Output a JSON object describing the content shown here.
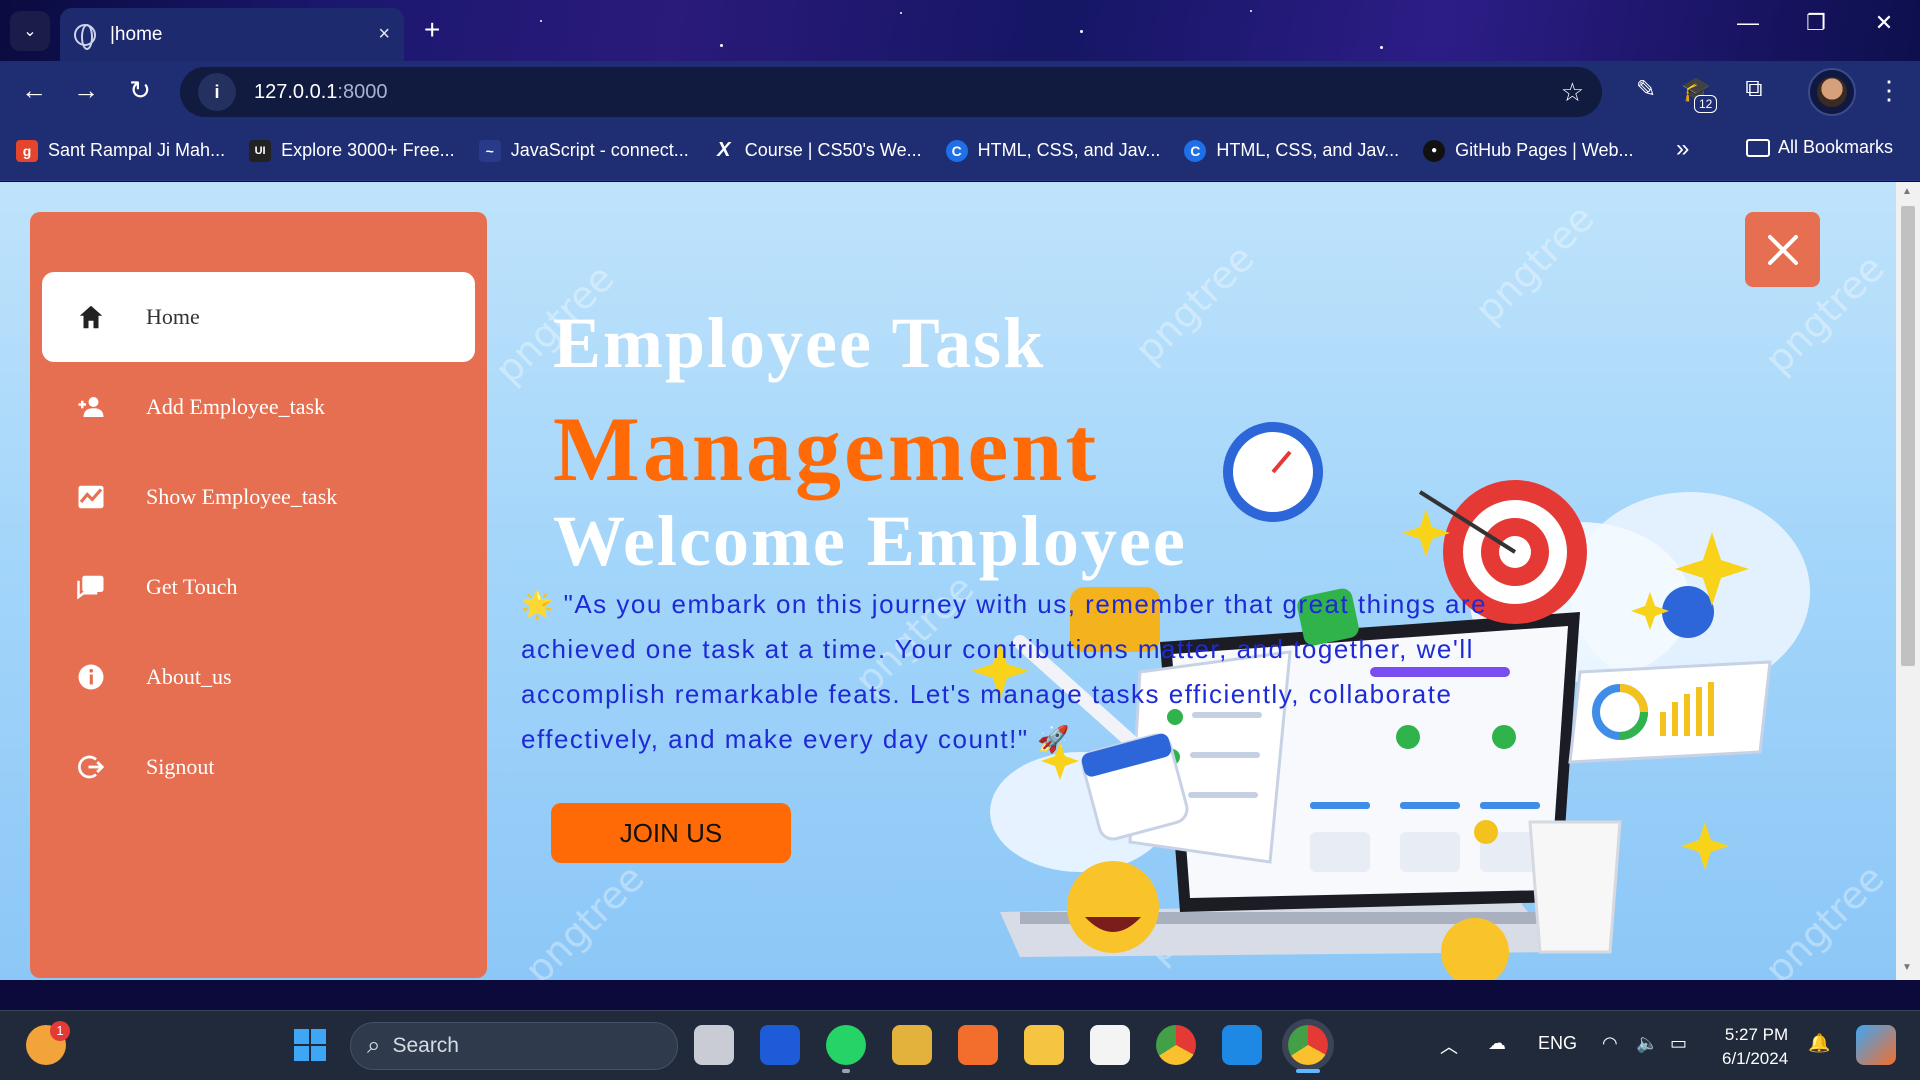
{
  "browser": {
    "tab_title": "|home",
    "tab_close": "×",
    "new_tab": "+",
    "window_controls": {
      "minimize": "—",
      "restore": "❐",
      "close": "✕"
    },
    "url_host": "127.0.0.1",
    "url_port": ":8000",
    "extensions_badge": "12",
    "bookmarks": [
      {
        "label": "Sant Rampal Ji Mah...",
        "icon": "sant-rampal-favicon",
        "color": "#e5452c",
        "glyph": "g"
      },
      {
        "label": "Explore 3000+ Free...",
        "icon": "ui-favicon",
        "color": "#222222",
        "glyph": "UI"
      },
      {
        "label": "JavaScript - connect...",
        "icon": "javascript-favicon",
        "color": "#2a3a8a",
        "glyph": "~"
      },
      {
        "label": "Course | CS50's We...",
        "icon": "x-favicon",
        "color": "#1f2d72",
        "glyph": "X"
      },
      {
        "label": "HTML, CSS, and Jav...",
        "icon": "c-favicon",
        "color": "#1e6fe8",
        "glyph": "C"
      },
      {
        "label": "HTML, CSS, and Jav...",
        "icon": "c-favicon",
        "color": "#1e6fe8",
        "glyph": "C"
      },
      {
        "label": "GitHub Pages | Web...",
        "icon": "github-favicon",
        "color": "#1f2d72",
        "glyph": "●"
      }
    ],
    "bookmarks_overflow": "»",
    "all_bookmarks": "All Bookmarks"
  },
  "sidebar": {
    "items": [
      {
        "label": "Home",
        "icon": "home-icon",
        "active": true
      },
      {
        "label": "Add Employee_task",
        "icon": "add-person-icon",
        "active": false
      },
      {
        "label": "Show Employee_task",
        "icon": "chart-icon",
        "active": false
      },
      {
        "label": "Get Touch",
        "icon": "message-icon",
        "active": false
      },
      {
        "label": "About_us",
        "icon": "info-icon",
        "active": false
      },
      {
        "label": "Signout",
        "icon": "signout-icon",
        "active": false
      }
    ]
  },
  "hero": {
    "line1": "Employee Task",
    "line2": "Management",
    "line3": "Welcome Employee",
    "quote": "\"As you embark on this journey with us, remember that great things are achieved one task at a time. Your contributions matter, and together, we'll accomplish remarkable feats. Let's manage tasks efficiently, collaborate effectively, and make every day count!\"",
    "quote_lead_emoji": "🌟",
    "quote_trail_emoji": "🚀",
    "join_button": "JOIN US",
    "watermark": "pngtree"
  },
  "taskbar": {
    "search_placeholder": "Search",
    "notification_count": "1",
    "language": "ENG",
    "time": "5:27 PM",
    "date": "6/1/2024"
  },
  "colors": {
    "sidebar": "#e76f51",
    "accent_orange": "#ff6a07",
    "quote_blue": "#1e2ad6",
    "page_bg": "#a4d6fa"
  }
}
